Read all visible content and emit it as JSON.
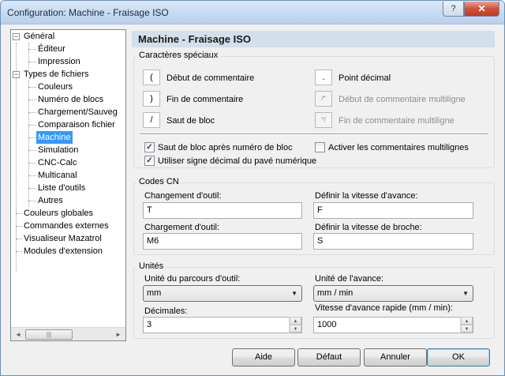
{
  "window": {
    "title": "Configuration: Machine - Fraisage ISO",
    "help_glyph": "?",
    "close_glyph": "✕"
  },
  "tree": {
    "items": [
      {
        "label": "Général",
        "expander": "−"
      },
      {
        "label": "Éditeur"
      },
      {
        "label": "Impression"
      },
      {
        "label": "Types de fichiers",
        "expander": "−"
      },
      {
        "label": "Couleurs"
      },
      {
        "label": "Numéro de blocs"
      },
      {
        "label": "Chargement/Sauveg"
      },
      {
        "label": "Comparaison fichier"
      },
      {
        "label": "Machine",
        "selected": true
      },
      {
        "label": "Simulation"
      },
      {
        "label": "CNC-Calc"
      },
      {
        "label": "Multicanal"
      },
      {
        "label": "Liste d'outils"
      },
      {
        "label": "Autres"
      },
      {
        "label": "Couleurs globales"
      },
      {
        "label": "Commandes externes"
      },
      {
        "label": "Visualiseur Mazatrol"
      },
      {
        "label": "Modules d'extension"
      }
    ],
    "scroll_left": "◄",
    "scroll_right": "►",
    "thumb_grip": "|||"
  },
  "panel": {
    "title": "Machine - Fraisage ISO"
  },
  "special_chars": {
    "title": "Caractères spéciaux",
    "rows": [
      {
        "char": "(",
        "label": "Début de commentaire"
      },
      {
        "char": ")",
        "label": "Fin de commentaire"
      },
      {
        "char": "/",
        "label": "Saut de bloc"
      },
      {
        "char": ".",
        "label": "Point décimal"
      },
      {
        "char": "/*",
        "label": "Début de commentaire multiligne"
      },
      {
        "char": "*/",
        "label": "Fin de commentaire multiligne"
      }
    ],
    "checkboxes": [
      {
        "label": "Saut de bloc après numéro de bloc",
        "checked": true
      },
      {
        "label": "Activer les commentaires multilignes",
        "checked": false
      },
      {
        "label": "Utiliser signe décimal du pavé numérique",
        "checked": true
      }
    ],
    "check_glyph": "✓"
  },
  "cn_codes": {
    "title": "Codes CN",
    "tool_change_label": "Changement d'outil:",
    "tool_change_value": "T",
    "tool_load_label": "Chargement d'outil:",
    "tool_load_value": "M6",
    "feed_rate_label": "Définir la vitesse d'avance:",
    "feed_rate_value": "F",
    "spindle_speed_label": "Définir la vitesse de broche:",
    "spindle_speed_value": "S"
  },
  "units": {
    "title": "Unités",
    "toolpath_unit_label": "Unité du parcours d'outil:",
    "toolpath_unit_value": "mm",
    "feed_unit_label": "Unité de l'avance:",
    "feed_unit_value": "mm / min",
    "decimals_label": "Décimales:",
    "decimals_value": "3",
    "rapid_feed_label": "Vitesse d'avance rapide (mm / min):",
    "rapid_feed_value": "1000",
    "combo_arrow": "▼",
    "spin_up": "▲",
    "spin_down": "▼"
  },
  "buttons": {
    "help": "Aide",
    "default": "Défaut",
    "cancel": "Annuler",
    "ok": "OK"
  }
}
